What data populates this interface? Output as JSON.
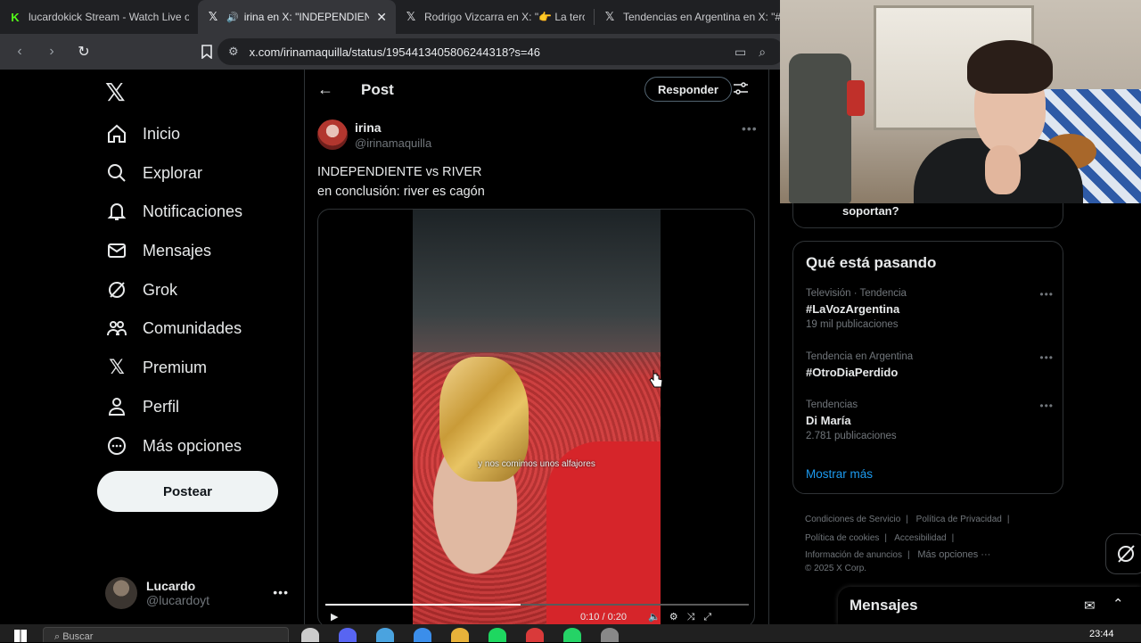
{
  "browser": {
    "tabs": [
      {
        "title": "lucardokick Stream - Watch Live on Kick",
        "active": false,
        "favicon": "kick-icon"
      },
      {
        "title": "irina en X: \"INDEPENDIENTE vs RIVER",
        "active": true,
        "favicon": "x-icon"
      },
      {
        "title": "Rodrigo Vizcarra en X: \"👉 La tercera",
        "active": false,
        "favicon": "x-icon"
      },
      {
        "title": "Tendencias en Argentina en X: \"#",
        "active": false,
        "favicon": "x-icon"
      }
    ],
    "url": "x.com/irinamaquilla/status/1954413405806244318?s=46"
  },
  "nav": {
    "items": [
      {
        "label": "Inicio",
        "icon": "home-icon"
      },
      {
        "label": "Explorar",
        "icon": "search-icon"
      },
      {
        "label": "Notificaciones",
        "icon": "bell-icon"
      },
      {
        "label": "Mensajes",
        "icon": "mail-icon"
      },
      {
        "label": "Grok",
        "icon": "grok-icon"
      },
      {
        "label": "Comunidades",
        "icon": "people-icon"
      },
      {
        "label": "Premium",
        "icon": "x-icon"
      },
      {
        "label": "Perfil",
        "icon": "person-icon"
      },
      {
        "label": "Más opciones",
        "icon": "more-circle-icon"
      }
    ],
    "post_button": "Postear",
    "account": {
      "name": "Lucardo",
      "handle": "@lucardoyt"
    }
  },
  "main": {
    "header_title": "Post",
    "reply_button": "Responder",
    "tweet": {
      "author_name": "irina",
      "author_handle": "@irinamaquilla",
      "text_line1": "INDEPENDIENTE vs RIVER",
      "text_line2": "en conclusión: river es cagón"
    },
    "video": {
      "caption": "y nos comimos unos alfajores",
      "progress": 0.46,
      "time": "0:10 / 0:20"
    }
  },
  "right": {
    "previous_card_text": "soportan?",
    "trends_title": "Qué está pasando",
    "trends": [
      {
        "meta": "Televisión · Tendencia",
        "name": "#LaVozArgentina",
        "count": "19 mil publicaciones"
      },
      {
        "meta": "Tendencia en Argentina",
        "name": "#OtroDiaPerdido",
        "count": ""
      },
      {
        "meta": "Tendencias",
        "name": "Di María",
        "count": "2.781 publicaciones"
      }
    ],
    "show_more": "Mostrar más",
    "footer": {
      "terms": "Condiciones de Servicio",
      "privacy": "Política de Privacidad",
      "cookies": "Política de cookies",
      "accessibility": "Accesibilidad",
      "ads": "Información de anuncios",
      "more": "Más opciones ···",
      "copyright": "© 2025 X Corp."
    }
  },
  "messages_drawer": {
    "title": "Mensajes"
  },
  "taskbar": {
    "search_placeholder": "Buscar",
    "clock": "23:44"
  }
}
